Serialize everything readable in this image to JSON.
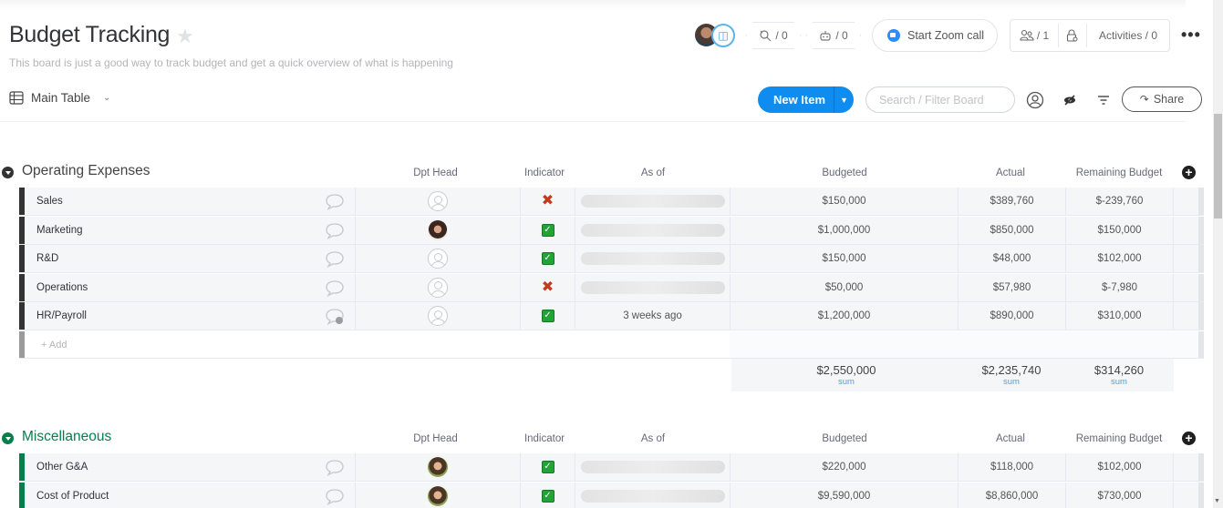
{
  "board": {
    "title": "Budget Tracking",
    "description": "This board is just a good way to track budget and get a quick overview of what is happening",
    "view_label": "Main Table"
  },
  "header": {
    "integrations_count": "/ 0",
    "automations_count": "/ 0",
    "zoom_label": "Start Zoom call",
    "members_count": "/ 1",
    "activities_label": "Activities / 0",
    "more_label": "•••"
  },
  "toolbar": {
    "new_item_label": "New Item",
    "search_placeholder": "Search / Filter Board",
    "share_label": "Share"
  },
  "columns": {
    "owner": "Dpt Head",
    "indicator": "Indicator",
    "as_of": "As of",
    "budgeted": "Budgeted",
    "actual": "Actual",
    "remaining": "Remaining Budget"
  },
  "colors": {
    "group1": "#333333",
    "group2": "#037f4c",
    "accent": "#0f8cf0",
    "check": "#21a336",
    "cross": "#c23b1f"
  },
  "groups": [
    {
      "title": "Operating Expenses",
      "add_label": "+ Add",
      "rows": [
        {
          "name": "Sales",
          "owner": "empty",
          "indicator": "cross",
          "as_of": "",
          "budgeted": "$150,000",
          "actual": "$389,760",
          "remaining": "$-239,760",
          "updates": 0
        },
        {
          "name": "Marketing",
          "owner": "photo",
          "indicator": "check",
          "as_of": "",
          "budgeted": "$1,000,000",
          "actual": "$850,000",
          "remaining": "$150,000",
          "updates": 0
        },
        {
          "name": "R&D",
          "owner": "empty",
          "indicator": "check",
          "as_of": "",
          "budgeted": "$150,000",
          "actual": "$48,000",
          "remaining": "$102,000",
          "updates": 0
        },
        {
          "name": "Operations",
          "owner": "empty",
          "indicator": "cross",
          "as_of": "",
          "budgeted": "$50,000",
          "actual": "$57,980",
          "remaining": "$-7,980",
          "updates": 0
        },
        {
          "name": "HR/Payroll",
          "owner": "empty",
          "indicator": "check",
          "as_of": "3 weeks ago",
          "budgeted": "$1,200,000",
          "actual": "$890,000",
          "remaining": "$310,000",
          "updates": 1
        }
      ],
      "summary": {
        "budgeted": "$2,550,000",
        "actual": "$2,235,740",
        "remaining": "$314,260",
        "label": "sum"
      }
    },
    {
      "title": "Miscellaneous",
      "rows": [
        {
          "name": "Other G&A",
          "owner": "photo",
          "indicator": "check",
          "as_of": "",
          "budgeted": "$220,000",
          "actual": "$118,000",
          "remaining": "$102,000",
          "updates": 0
        },
        {
          "name": "Cost of Product",
          "owner": "photo",
          "indicator": "check",
          "as_of": "",
          "budgeted": "$9,590,000",
          "actual": "$8,860,000",
          "remaining": "$730,000",
          "updates": 0
        }
      ]
    }
  ]
}
